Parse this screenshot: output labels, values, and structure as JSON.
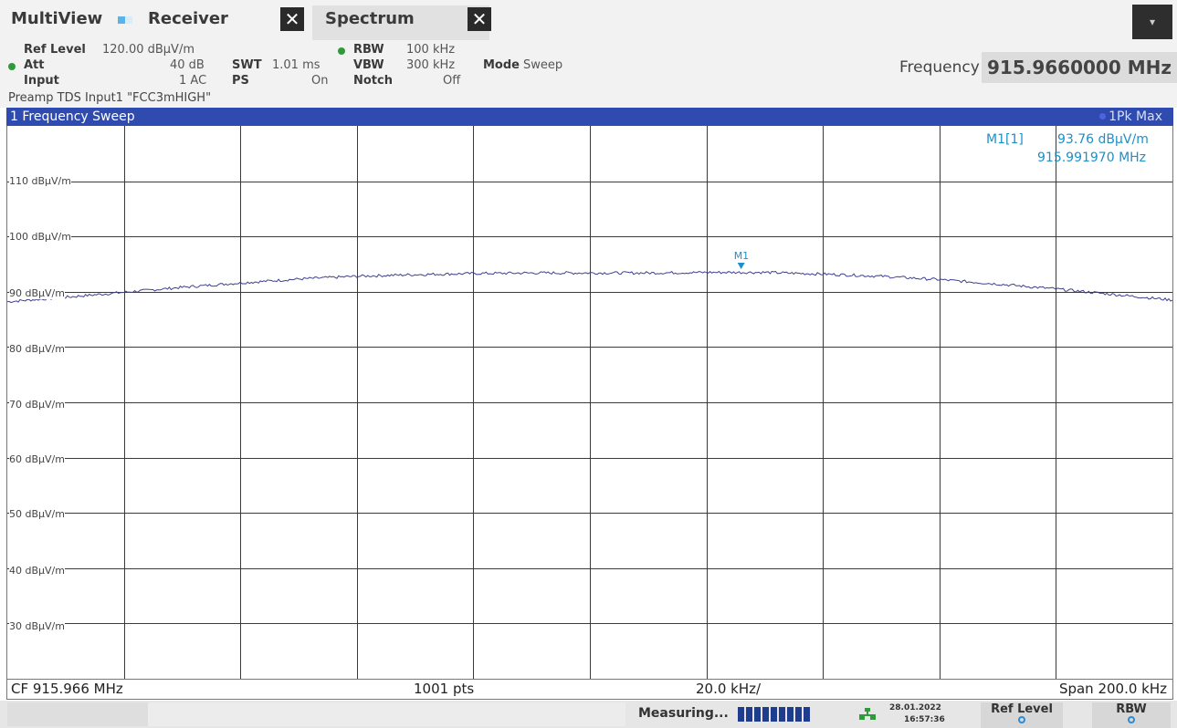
{
  "tabs": {
    "multiview": "MultiView",
    "receiver": "Receiver",
    "spectrum": "Spectrum",
    "close_glyph": "✕",
    "menu_glyph": "▾"
  },
  "settings": {
    "ref_level_label": "Ref Level",
    "ref_level_value": "120.00 dBµV/m",
    "att_label": "Att",
    "att_value": "40 dB",
    "swt_label": "SWT",
    "swt_value": "1.01 ms",
    "input_label": "Input",
    "input_value": "1 AC",
    "ps_label": "PS",
    "ps_value": "On",
    "rbw_label": "RBW",
    "rbw_value": "100 kHz",
    "vbw_label": "VBW",
    "vbw_value": "300 kHz",
    "notch_label": "Notch",
    "notch_value": "Off",
    "mode_label": "Mode",
    "mode_value": "Sweep",
    "preamp_line": "Preamp TDS Input1 \"FCC3mHIGH\"",
    "frequency_label": "Frequency",
    "frequency_value": "915.9660000 MHz",
    "indicator_color": "#2e9a3a"
  },
  "diagram": {
    "title": "1 Frequency Sweep",
    "trace_label": "1Pk Max",
    "marker": {
      "name": "M1[1]",
      "level": "93.76 dBµV/m",
      "frequency": "915.991970 MHz",
      "label": "M1"
    }
  },
  "chart_data": {
    "type": "line",
    "ylabel_unit": "dBµV/m",
    "ylim": [
      20,
      120
    ],
    "yticks": [
      "110 dBµV/m",
      "100 dBµV/m",
      "90 dBµV/m",
      "80 dBµV/m",
      "70 dBµV/m",
      "60 dBµV/m",
      "50 dBµV/m",
      "40 dBµV/m",
      "30 dBµV/m"
    ],
    "xlim_mhz": [
      915.866,
      916.066
    ],
    "grid": true,
    "series": [
      {
        "color": "#3f3f8f",
        "x_mhz": [
          915.866,
          915.876,
          915.886,
          915.896,
          915.906,
          915.916,
          915.926,
          915.936,
          915.946,
          915.956,
          915.966,
          915.976,
          915.986,
          915.996,
          916.006,
          916.016,
          916.026,
          916.036,
          916.046,
          916.056,
          916.066
        ],
        "y": [
          88.2,
          89.0,
          89.9,
          90.8,
          91.6,
          92.3,
          92.8,
          93.1,
          93.3,
          93.4,
          93.4,
          93.4,
          93.5,
          93.5,
          93.2,
          92.8,
          92.2,
          91.4,
          90.5,
          89.5,
          88.5
        ]
      }
    ],
    "marker": {
      "x_mhz": 915.99197,
      "y": 93.76
    }
  },
  "footer": {
    "cf": "CF 915.966 MHz",
    "pts": "1001 pts",
    "div": "20.0 kHz/",
    "span": "Span 200.0 kHz"
  },
  "status": {
    "measuring": "Measuring...",
    "progress_fraction": 1.0,
    "date": "28.01.2022",
    "time": "16:57:36",
    "softkey_ref_level": "Ref Level",
    "softkey_rbw": "RBW"
  }
}
